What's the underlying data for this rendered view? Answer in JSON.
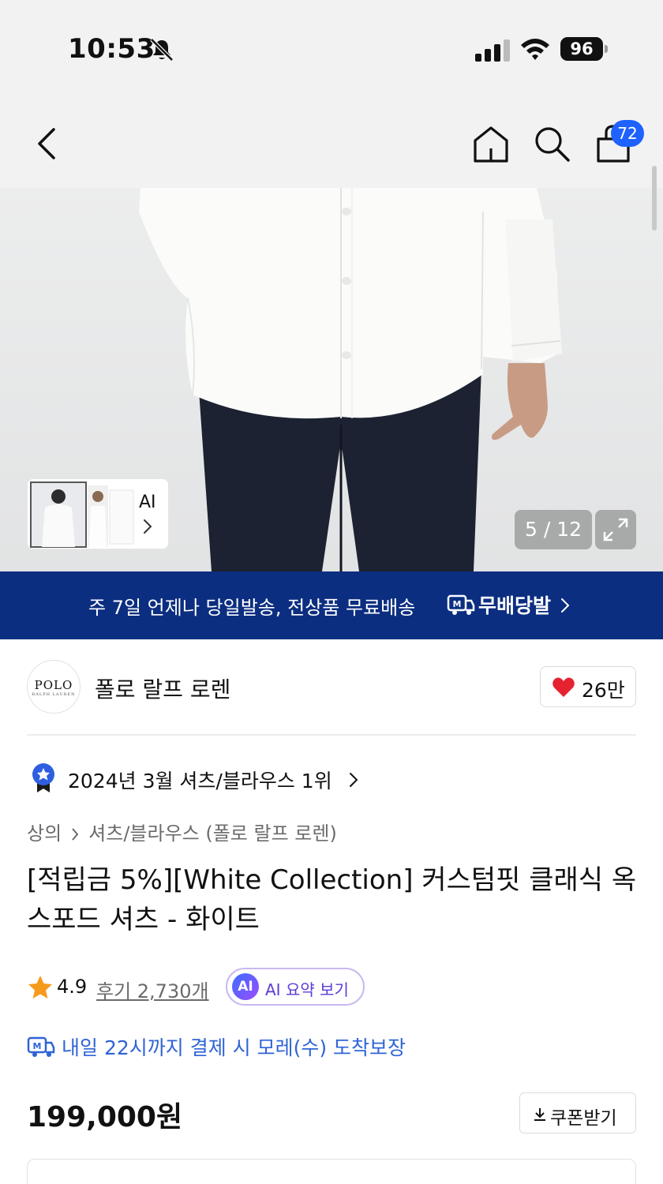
{
  "status_bar": {
    "time": "10:53",
    "battery": "96"
  },
  "nav": {
    "cart_count": "72"
  },
  "gallery": {
    "ai_label": "AI",
    "counter": "5 / 12"
  },
  "banner": {
    "text": "주 7일 언제나 당일발송, 전상품 무료배송",
    "brand": "무배당발"
  },
  "brand": {
    "logo_text": "POLO",
    "logo_subtext": "RALPH LAUREN",
    "name": "폴로 랄프 로렌",
    "likes": "26만"
  },
  "ranking": {
    "text": "2024년 3월 셔츠/블라우스 1위"
  },
  "breadcrumb": {
    "level1": "상의",
    "level2": "셔츠/블라우스 (폴로 랄프 로렌)"
  },
  "product": {
    "title": "[적립금 5%][White Collection] 커스텀핏 클래식 옥스포드 셔츠 - 화이트",
    "rating": "4.9",
    "reviews": "후기 2,730개",
    "ai_badge": "AI",
    "ai_summary": "AI 요약 보기",
    "delivery": "내일 22시까지 결제 시 모레(수) 도착보장",
    "price": "199,000원",
    "coupon": "쿠폰받기"
  },
  "colors": {
    "accent_blue": "#1e62ff",
    "banner_navy": "#0b2e80",
    "delivery_blue": "#2f64d6",
    "heart_red": "#e5222f"
  }
}
